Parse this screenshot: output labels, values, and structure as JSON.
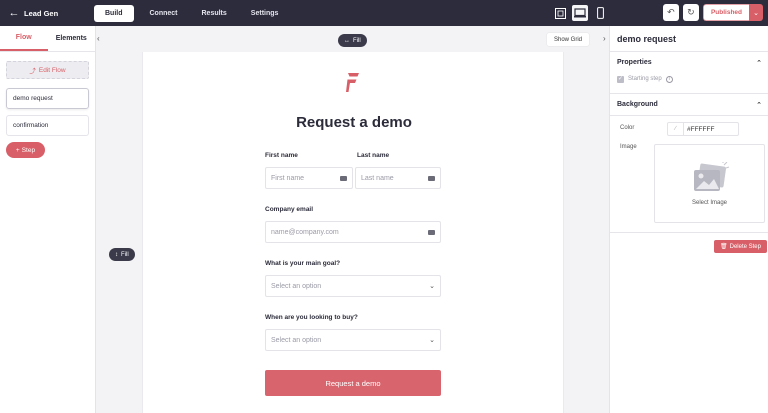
{
  "topbar": {
    "back_icon": "arrow-left-icon",
    "app_title": "Lead Gen",
    "tabs": [
      {
        "label": "Build",
        "active": true
      },
      {
        "label": "Connect",
        "active": false
      },
      {
        "label": "Results",
        "active": false
      },
      {
        "label": "Settings",
        "active": false
      }
    ],
    "publish_label": "Published"
  },
  "left_panel": {
    "tabs": [
      {
        "label": "Flow",
        "active": true
      },
      {
        "label": "Elements",
        "active": false
      }
    ],
    "edit_flow_label": "Edit Flow",
    "steps": [
      {
        "label": "demo request",
        "selected": true
      },
      {
        "label": "confirmation",
        "selected": false
      }
    ],
    "add_step_label": "Step"
  },
  "canvas": {
    "fill_top_label": "Fill",
    "fill_side_label": "Fill",
    "show_grid_label": "Show Grid",
    "form": {
      "title": "Request a demo",
      "first_name_label": "First name",
      "first_name_placeholder": "First name",
      "last_name_label": "Last name",
      "last_name_placeholder": "Last name",
      "email_label": "Company email",
      "email_placeholder": "name@company.com",
      "goal_label": "What is your main goal?",
      "goal_placeholder": "Select an option",
      "buy_label": "When are you looking to buy?",
      "buy_placeholder": "Select an option",
      "submit_label": "Request a demo"
    }
  },
  "right_panel": {
    "title": "demo request",
    "properties_heading": "Properties",
    "starting_step_label": "Starting step",
    "background_heading": "Background",
    "color_label": "Color",
    "color_value": "#FFFFFF",
    "image_label": "Image",
    "select_image_label": "Select Image",
    "delete_step_label": "Delete Step"
  },
  "colors": {
    "accent": "#d85f67",
    "topbar": "#2c2c3c"
  }
}
